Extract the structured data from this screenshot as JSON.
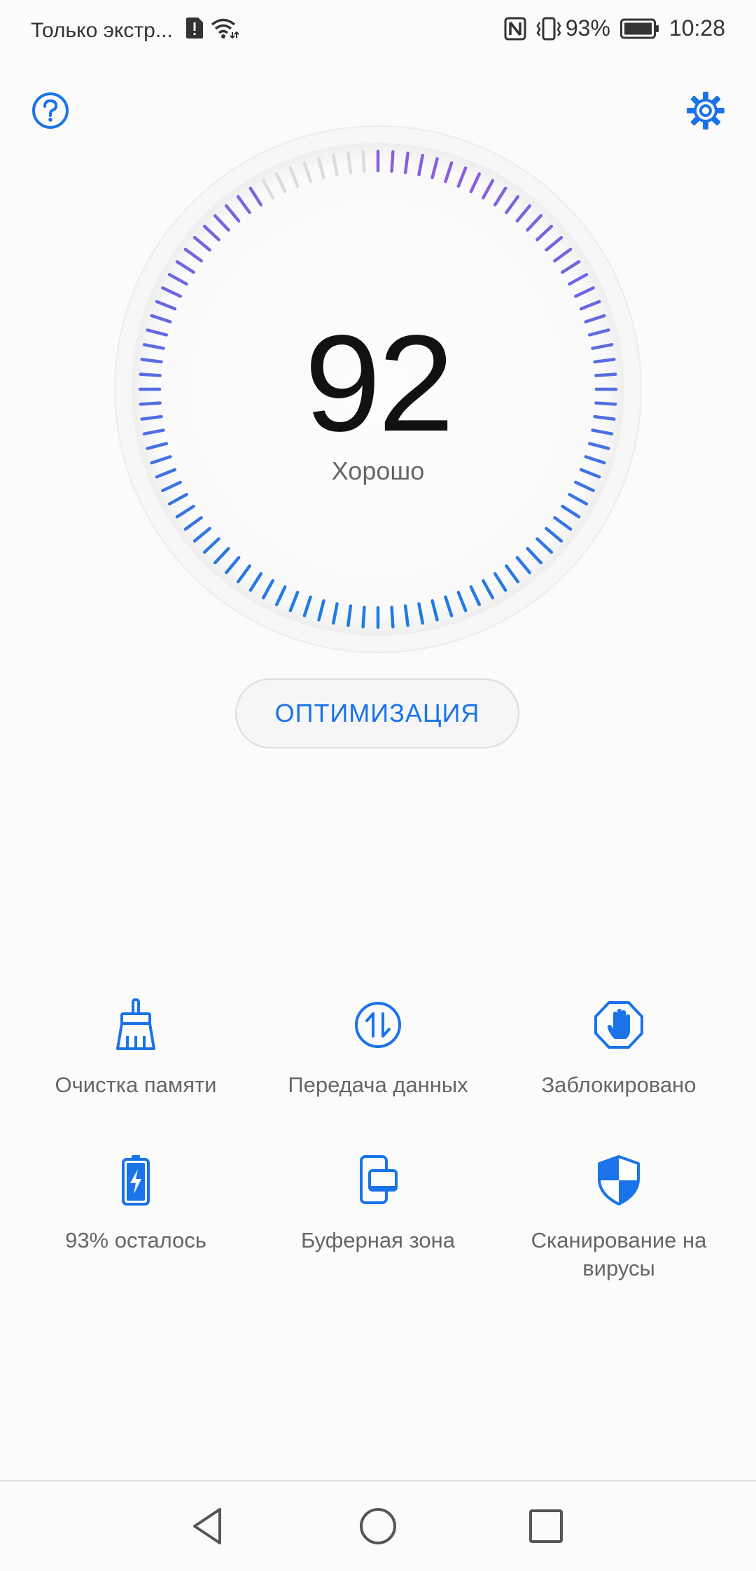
{
  "status_bar": {
    "carrier": "Только экстр...",
    "battery_percent": "93%",
    "time": "10:28",
    "icons": [
      "sim-alert-icon",
      "wifi-icon",
      "nfc-icon",
      "vibrate-icon",
      "battery-icon"
    ]
  },
  "header": {
    "help_icon": "help-circle-icon",
    "settings_icon": "gear-icon"
  },
  "score": {
    "value": "92",
    "label": "Хорошо",
    "level": 0.92
  },
  "optimize_button": {
    "label": "ОПТИМИЗАЦИЯ"
  },
  "tools": [
    {
      "label": "Очистка памяти",
      "icon": "broom-icon"
    },
    {
      "label": "Передача данных",
      "icon": "data-transfer-icon"
    },
    {
      "label": "Заблокировано",
      "icon": "blocked-hand-icon"
    },
    {
      "label": "93% осталось",
      "icon": "battery-charging-icon"
    },
    {
      "label": "Буферная зона",
      "icon": "dual-screen-icon"
    },
    {
      "label": "Сканирование на вирусы",
      "icon": "shield-icon"
    }
  ],
  "navbar": {
    "icons": [
      "back-icon",
      "home-icon",
      "recents-icon"
    ]
  },
  "colors": {
    "accent": "#1a73e8",
    "gauge_start": "#8a5fe0",
    "gauge_end": "#1f7be6",
    "gauge_inactive": "#dcdcdc",
    "text_primary": "#111111",
    "text_secondary": "#666666"
  }
}
